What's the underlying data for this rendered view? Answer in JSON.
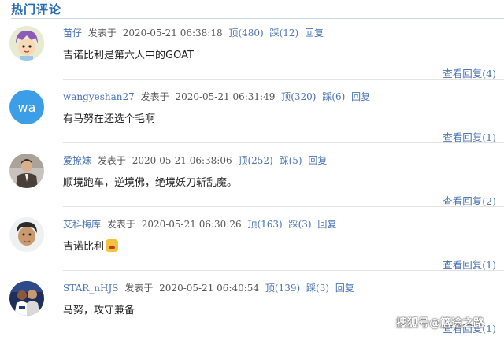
{
  "header": {
    "title": "热门评论"
  },
  "comments": [
    {
      "user": "苗仔",
      "posted_label": "发表于",
      "time": "2020-05-21 06:38:18",
      "up_label": "顶",
      "up_count": "(480)",
      "down_label": "踩",
      "down_count": "(12)",
      "reply_label": "回复",
      "text": "吉诺比利是第六人中的GOAT",
      "view_replies": "查看回复(4)",
      "avatar_kind": "cartoon-purple-hair"
    },
    {
      "user": "wangyeshan27",
      "posted_label": "发表于",
      "time": "2020-05-21 06:31:49",
      "up_label": "顶",
      "up_count": "(320)",
      "down_label": "踩",
      "down_count": "(6)",
      "reply_label": "回复",
      "text": "有马努在还选个毛啊",
      "view_replies": "查看回复(1)",
      "avatar_text": "wa",
      "avatar_kind": "initials-blue"
    },
    {
      "user": "爱撩妹",
      "posted_label": "发表于",
      "time": "2020-05-21 06:38:06",
      "up_label": "顶",
      "up_count": "(252)",
      "down_label": "踩",
      "down_count": "(5)",
      "reply_label": "回复",
      "text": "顺境跑车，逆境佛，绝境妖刀斩乱魔。",
      "view_replies": "查看回复(2)",
      "avatar_kind": "photo-man-suit"
    },
    {
      "user": "艾科梅库",
      "posted_label": "发表于",
      "time": "2020-05-21 06:30:26",
      "up_label": "顶",
      "up_count": "(163)",
      "down_label": "踩",
      "down_count": "(3)",
      "reply_label": "回复",
      "text": "吉诺比利",
      "has_emoji": true,
      "view_replies": "查看回复(1)",
      "avatar_kind": "cartoon-face"
    },
    {
      "user": "STAR_nHJS",
      "posted_label": "发表于",
      "time": "2020-05-21 06:40:54",
      "up_label": "顶",
      "up_count": "(139)",
      "down_label": "踩",
      "down_count": "(3)",
      "reply_label": "回复",
      "text": "马努，攻守兼备",
      "view_replies": "查看回复(1)",
      "avatar_kind": "photo-players"
    }
  ],
  "watermark": "搜狐号@篮途之路",
  "colors": {
    "accent": "#2a6bb4",
    "link": "#4a74b5",
    "avatar_blue": "#3d9ee8"
  }
}
